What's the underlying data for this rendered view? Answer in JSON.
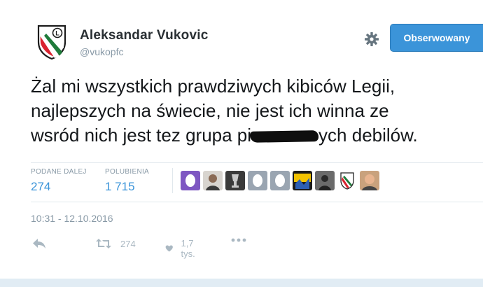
{
  "user": {
    "name": "Aleksandar Vukovic",
    "handle": "@vukopfc"
  },
  "follow_button": {
    "label": "Obserwowany"
  },
  "tweet": {
    "line1": "Żal mi wszystkich prawdziwych kibiców Legii,",
    "line2": "najlepszych na świecie, nie jest ich winna ze",
    "line3_before": "wsród nich jest tez grupa pi",
    "line3_after": "ych debilów."
  },
  "stats": {
    "retweets": {
      "label": "PODANE DALEJ",
      "value": "274"
    },
    "likes": {
      "label": "POLUBIENIA",
      "value": "1 715"
    }
  },
  "timestamp": "10:31 - 12.10.2016",
  "actions": {
    "retweet_count": "274",
    "like_count": "1,7 tys."
  },
  "icons": {
    "gear": "gear-icon",
    "reply": "reply-icon",
    "retweet": "retweet-icon",
    "like": "heart-icon",
    "more": "more-dots-icon"
  },
  "colors": {
    "accent": "#3b94d9",
    "muted": "#8899a6",
    "icon_gray": "#aab8c2"
  }
}
